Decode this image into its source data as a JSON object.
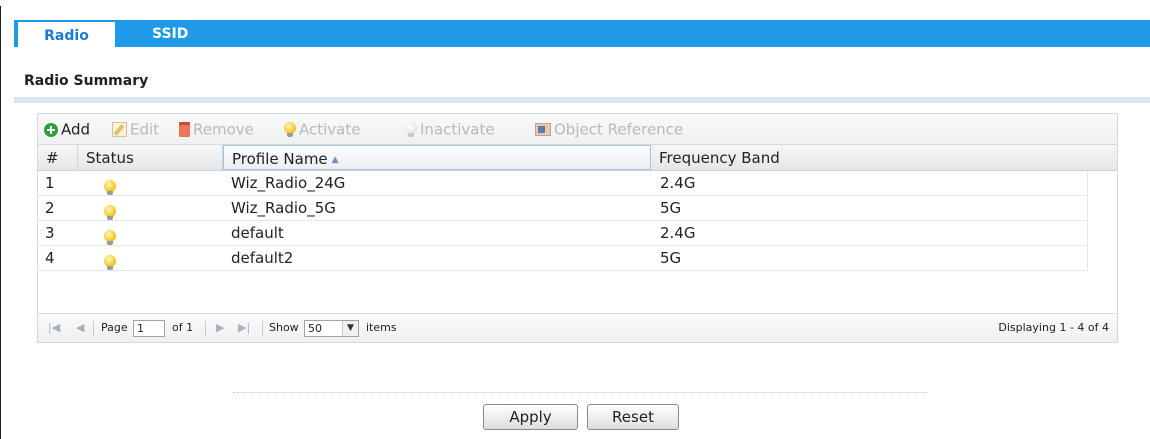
{
  "tabs": [
    {
      "label": "Radio",
      "active": true
    },
    {
      "label": "SSID",
      "active": false
    }
  ],
  "section": {
    "title": "Radio Summary"
  },
  "toolbar": {
    "add": "Add",
    "edit": "Edit",
    "remove": "Remove",
    "activate": "Activate",
    "inactivate": "Inactivate",
    "object_reference": "Object Reference"
  },
  "table": {
    "columns": {
      "index": "#",
      "status": "Status",
      "profile_name": "Profile Name",
      "frequency_band": "Frequency Band"
    },
    "sorted_column": "profile_name",
    "rows": [
      {
        "index": "1",
        "status": "active",
        "profile_name": "Wiz_Radio_24G",
        "frequency_band": "2.4G"
      },
      {
        "index": "2",
        "status": "active",
        "profile_name": "Wiz_Radio_5G",
        "frequency_band": "5G"
      },
      {
        "index": "3",
        "status": "active",
        "profile_name": "default",
        "frequency_band": "2.4G"
      },
      {
        "index": "4",
        "status": "active",
        "profile_name": "default2",
        "frequency_band": "5G"
      }
    ]
  },
  "pager": {
    "page_label": "Page",
    "page_value": "1",
    "of_label": "of 1",
    "show_label": "Show",
    "page_size": "50",
    "items_label": "items",
    "display_text": "Displaying 1 - 4 of 4"
  },
  "buttons": {
    "apply": "Apply",
    "reset": "Reset"
  },
  "colors": {
    "tab_bar": "#1e9ae8",
    "active_tab_text": "#1a7ad0",
    "add_icon": "#2f9e3a",
    "status_active": "#f3c51f"
  }
}
